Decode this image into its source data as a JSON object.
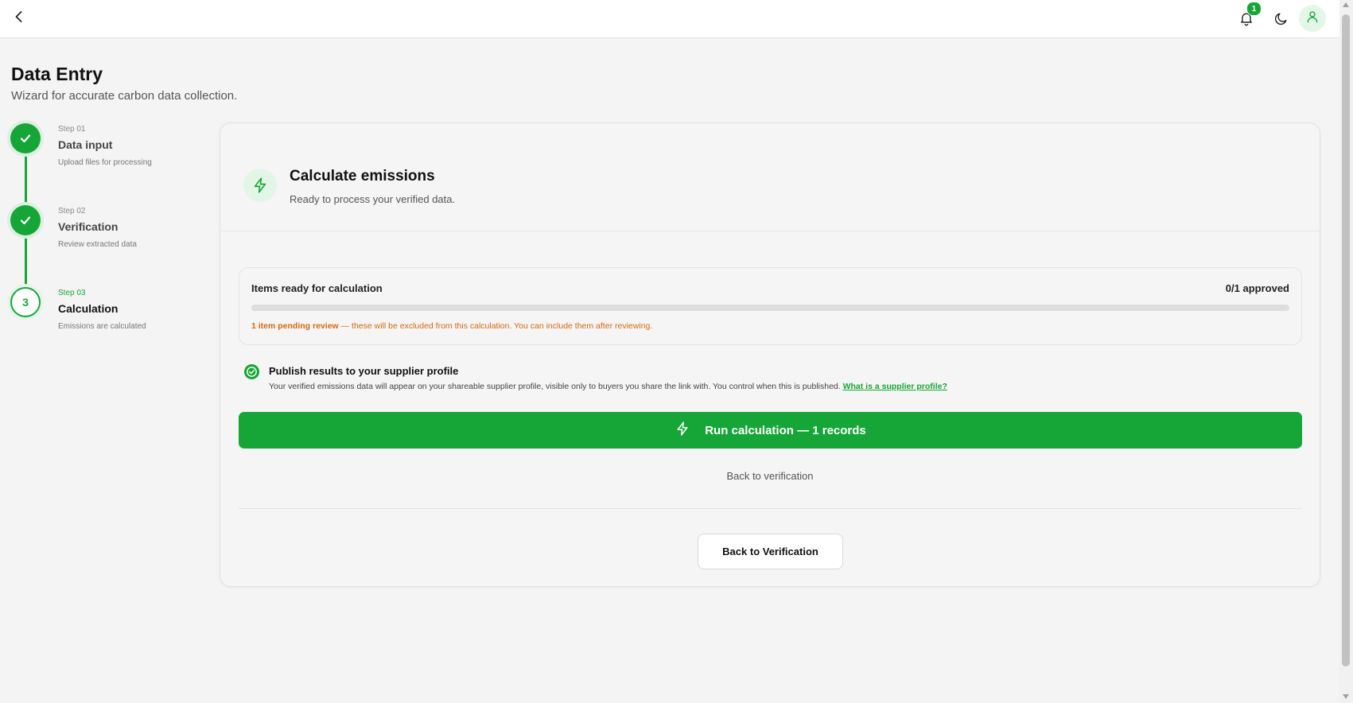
{
  "topbar": {
    "notifications_count": "1"
  },
  "header": {
    "title": "Data Entry",
    "subtitle": "Wizard for accurate carbon data collection."
  },
  "steps": [
    {
      "kicker": "Step 01",
      "title": "Data input",
      "desc": "Upload files for processing",
      "status": "done"
    },
    {
      "kicker": "Step 02",
      "title": "Verification",
      "desc": "Review extracted data",
      "status": "done"
    },
    {
      "kicker": "Step 03",
      "title": "Calculation",
      "desc": "Emissions are calculated",
      "status": "current",
      "number": "3"
    }
  ],
  "card": {
    "title": "Calculate emissions",
    "subtitle": "Ready to process your verified data.",
    "ready": {
      "label": "Items ready for calculation",
      "count": "0/1 approved",
      "progress_fraction": 0,
      "pending_bold": "1 item pending review",
      "pending_rest": " — these will be excluded from this calculation. You can include them after reviewing."
    },
    "publish": {
      "title": "Publish results to your supplier profile",
      "desc": "Your verified emissions data will appear on your shareable supplier profile, visible only to buyers you share the link with. You control when this is published. ",
      "link": "What is a supplier profile?"
    },
    "run_button": "Run calculation — 1 records",
    "back_link": "Back to verification",
    "back_button": "Back to Verification"
  },
  "colors": {
    "accent": "#16a637",
    "warning": "#d5690b"
  },
  "icons": {
    "back": "chevron-left-icon",
    "bell": "bell-icon",
    "theme": "moon-icon",
    "user": "user-icon",
    "step_done": "check-icon",
    "calculate": "lightning-icon",
    "publish": "check-circle-icon"
  }
}
